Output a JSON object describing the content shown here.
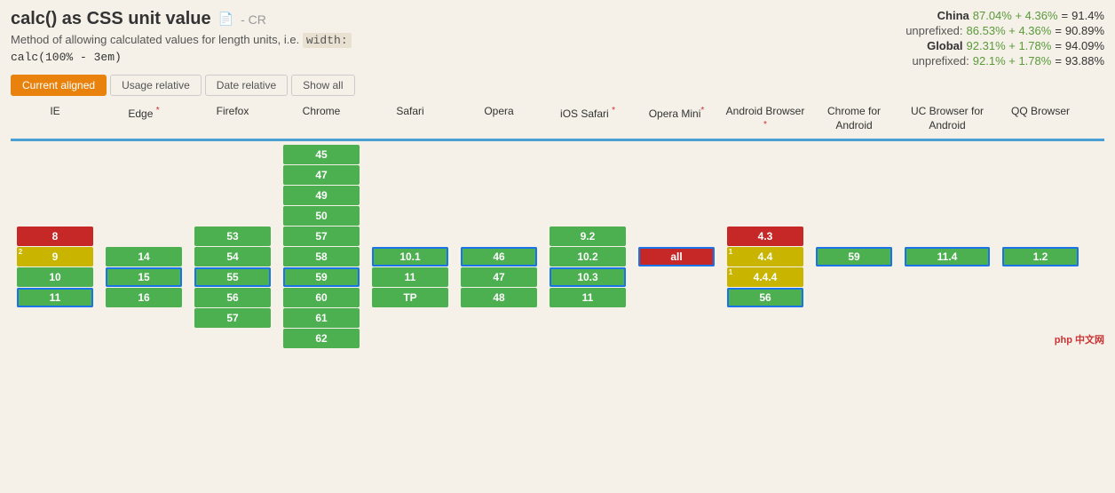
{
  "page": {
    "title": "calc() as CSS unit value",
    "title_icon": "📄",
    "cr_badge": "- CR",
    "description": "Method of allowing calculated values for length units, i.e.",
    "code_inline": "width:",
    "code_block": "calc(100% - 3em)",
    "footer_logo": "php 中文网"
  },
  "stats": {
    "china_label": "China",
    "china_green": "87.04% + 4.36%",
    "china_eq": "=",
    "china_val": "91.4%",
    "china_unprefixed_label": "unprefixed:",
    "china_unprefixed_green": "86.53% + 4.36%",
    "china_unprefixed_eq": "=",
    "china_unprefixed_val": "90.89%",
    "global_label": "Global",
    "global_green": "92.31% + 1.78%",
    "global_eq": "=",
    "global_val": "94.09%",
    "global_unprefixed_label": "unprefixed:",
    "global_unprefixed_green": "92.1%  + 1.78%",
    "global_unprefixed_eq": "=",
    "global_unprefixed_val": "93.88%"
  },
  "tabs": {
    "current_aligned": "Current aligned",
    "usage_relative": "Usage relative",
    "date_relative": "Date relative",
    "show_all": "Show all"
  },
  "browsers": [
    {
      "name": "IE",
      "asterisk": false
    },
    {
      "name": "Edge",
      "asterisk": true
    },
    {
      "name": "Firefox",
      "asterisk": false
    },
    {
      "name": "Chrome",
      "asterisk": false
    },
    {
      "name": "Safari",
      "asterisk": false
    },
    {
      "name": "Opera",
      "asterisk": false
    },
    {
      "name": "iOS Safari",
      "asterisk": true
    },
    {
      "name": "Opera Mini",
      "asterisk": true
    },
    {
      "name": "Android Browser",
      "asterisk": true
    },
    {
      "name": "Chrome for Android",
      "asterisk": false
    },
    {
      "name": "UC Browser for Android",
      "asterisk": false
    },
    {
      "name": "QQ Browser",
      "asterisk": false
    }
  ],
  "columns": {
    "ie": [
      "",
      "",
      "",
      "",
      "",
      "8",
      "9",
      "10",
      "11",
      ""
    ],
    "edge": [
      "",
      "",
      "",
      "",
      "",
      "",
      "",
      "",
      "14",
      "15",
      "16"
    ],
    "firefox": [
      "",
      "",
      "",
      "",
      "",
      "",
      "",
      "53",
      "54",
      "55",
      "56",
      "57"
    ],
    "chrome": [
      "45",
      "47",
      "49",
      "50",
      "57",
      "58",
      "59",
      "60",
      "61",
      "62"
    ],
    "safari": [
      "",
      "",
      "",
      "",
      "",
      "",
      "10.1",
      "11",
      "TP",
      ""
    ],
    "opera": [
      "",
      "",
      "",
      "",
      "",
      "",
      "46",
      "47",
      "48",
      ""
    ],
    "ios_safari": [
      "",
      "",
      "",
      "",
      "9.2",
      "10.2",
      "10.3",
      "11",
      ""
    ],
    "opera_mini": [
      "",
      "",
      "",
      "",
      "",
      "",
      "all",
      "",
      ""
    ],
    "android_browser": [
      "",
      "",
      "",
      "",
      "4.3",
      "4.4",
      "4.4.4",
      "56",
      ""
    ],
    "chrome_android": [
      "",
      "",
      "",
      "",
      "",
      "",
      "59",
      "",
      ""
    ],
    "uc_android": [
      "",
      "",
      "",
      "",
      "",
      "",
      "11.4",
      "",
      ""
    ],
    "qq_browser": [
      "",
      "",
      "",
      "",
      "",
      "",
      "1.2",
      "",
      ""
    ]
  }
}
